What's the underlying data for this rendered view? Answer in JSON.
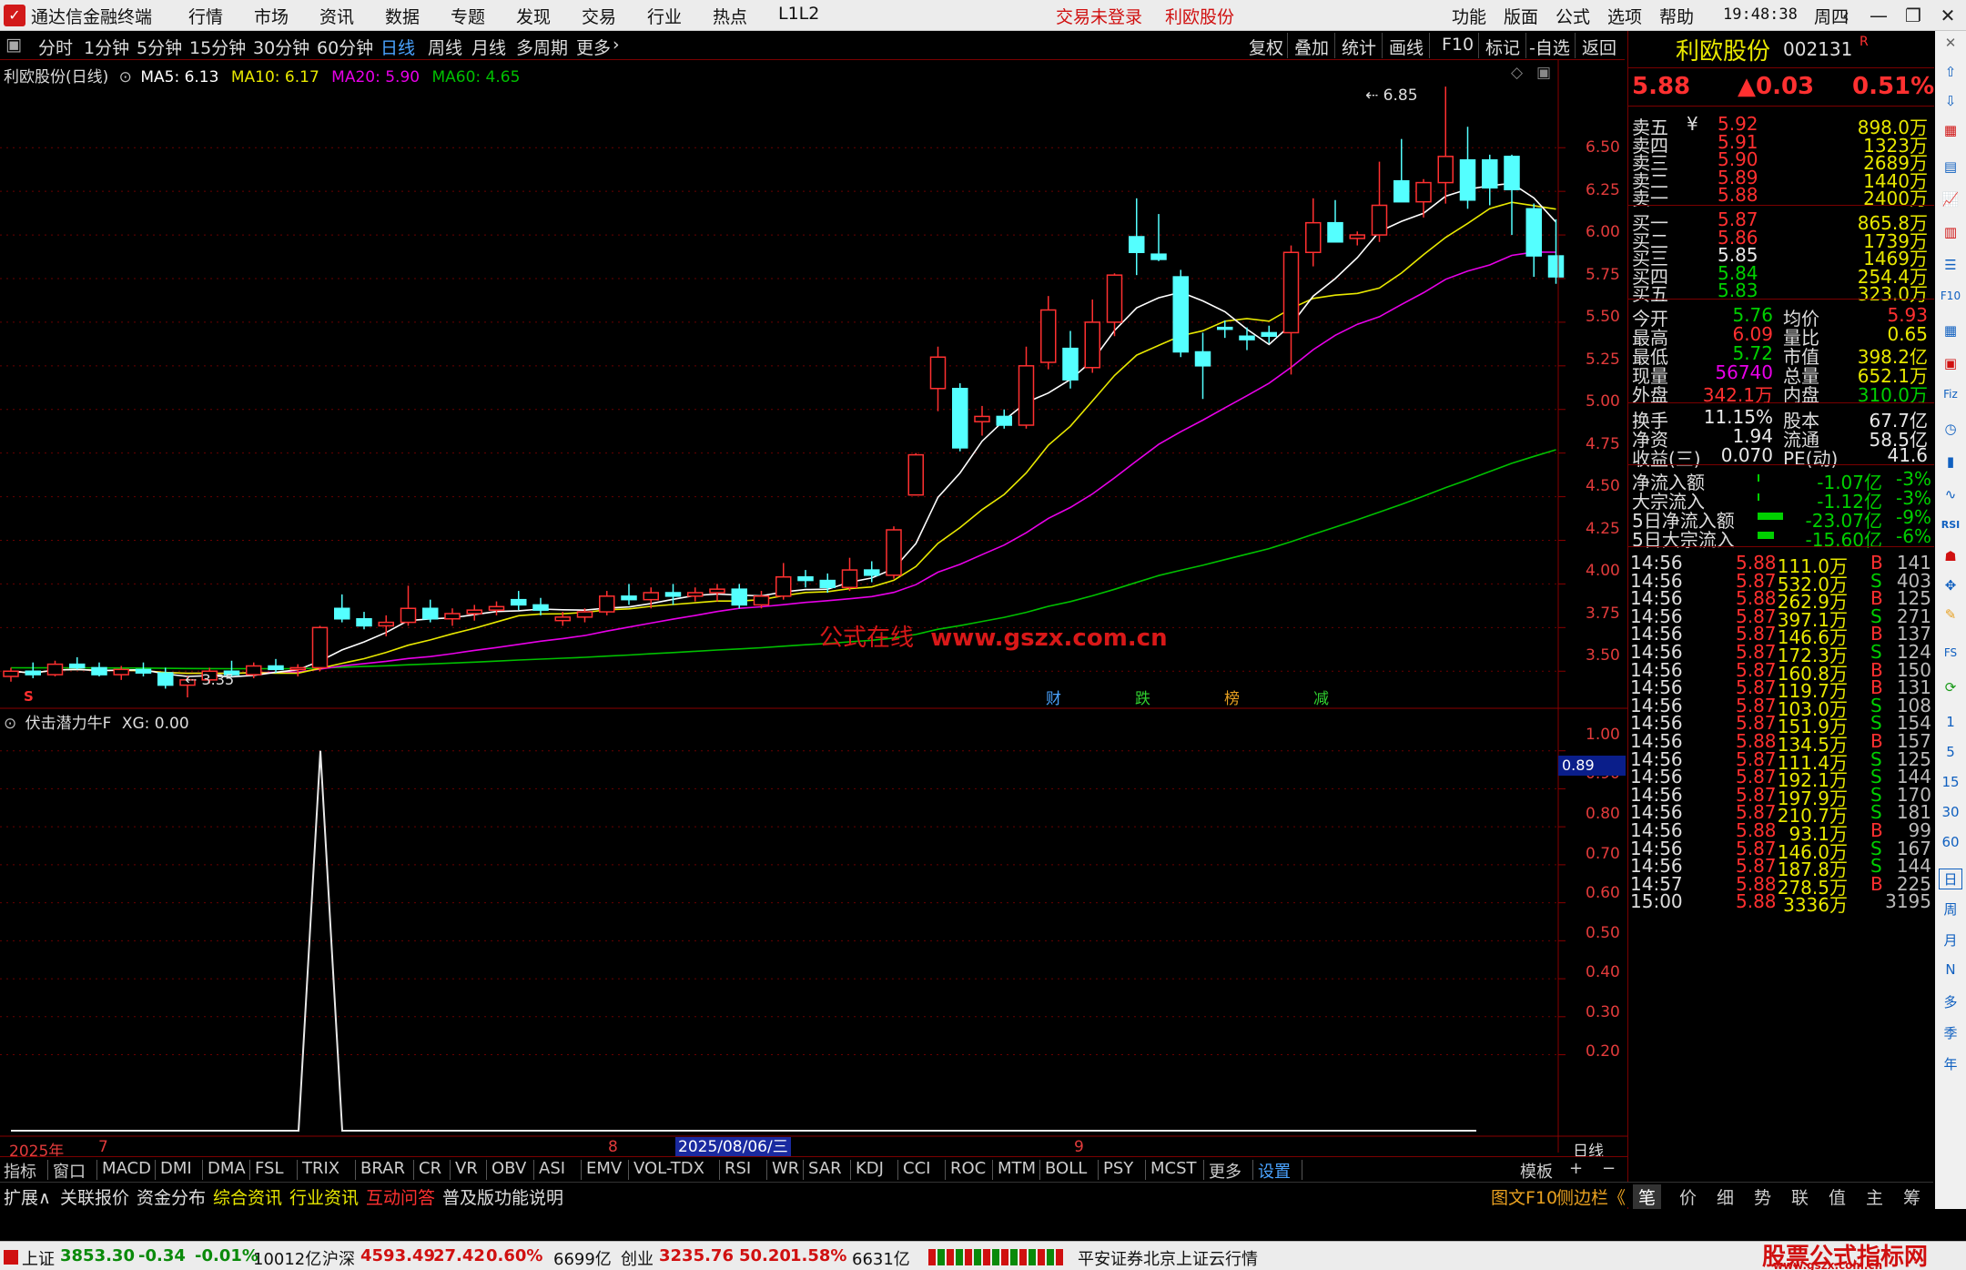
{
  "app": {
    "title": "通达信金融终端"
  },
  "menu": {
    "items": [
      "行情",
      "市场",
      "资讯",
      "数据",
      "专题",
      "发现",
      "交易",
      "行业",
      "热点",
      "L1L2"
    ],
    "login": "交易未登录",
    "stock": "利欧股份",
    "right": [
      "功能",
      "版面",
      "公式",
      "选项",
      "帮助"
    ],
    "time": "19:48:38",
    "weekday": "周四"
  },
  "periods": [
    "分时",
    "1分钟",
    "5分钟",
    "15分钟",
    "30分钟",
    "60分钟",
    "日线",
    "周线",
    "月线",
    "多周期",
    "更多"
  ],
  "active_period": "日线",
  "chart_tools": [
    "复权",
    "叠加",
    "统计",
    "画线",
    "F10",
    "标记",
    "-自选",
    "返回"
  ],
  "legend": {
    "stock": "利欧股份(日线)",
    "ma5": "MA5: 6.13",
    "ma10": "MA10: 6.17",
    "ma20": "MA20: 5.90",
    "ma60": "MA60: 4.65"
  },
  "watermark": {
    "cn": "公式在线",
    "url": "www.gszx.com.cn"
  },
  "price_axis": [
    "6.50",
    "6.25",
    "6.00",
    "5.75",
    "5.50",
    "5.25",
    "5.00",
    "4.75",
    "4.50",
    "4.25",
    "4.00",
    "3.75",
    "3.50"
  ],
  "events": [
    "财",
    "跌",
    "榜",
    "减"
  ],
  "high_label": "6.85",
  "low_label": "3.35",
  "s_mark": "S",
  "indicator": {
    "name": "伏击潜力牛F",
    "value": "XG: 0.00",
    "current": "0.89",
    "axis": [
      "1.00",
      "0.90",
      "0.80",
      "0.70",
      "0.60",
      "0.50",
      "0.40",
      "0.30",
      "0.20"
    ]
  },
  "xaxis": {
    "year": "2025年",
    "m7": "7",
    "m8": "8",
    "cursor_date": "2025/08/06/三",
    "m9": "9",
    "period": "日线"
  },
  "chart_data": {
    "type": "candlestick",
    "ylim": [
      3.35,
      6.95
    ],
    "candles": [
      [
        3.47,
        3.52,
        3.44,
        3.5
      ],
      [
        3.5,
        3.55,
        3.46,
        3.48
      ],
      [
        3.48,
        3.56,
        3.47,
        3.54
      ],
      [
        3.54,
        3.58,
        3.51,
        3.52
      ],
      [
        3.52,
        3.55,
        3.47,
        3.48
      ],
      [
        3.48,
        3.53,
        3.45,
        3.51
      ],
      [
        3.51,
        3.55,
        3.47,
        3.49
      ],
      [
        3.49,
        3.52,
        3.4,
        3.42
      ],
      [
        3.42,
        3.47,
        3.35,
        3.45
      ],
      [
        3.45,
        3.52,
        3.43,
        3.5
      ],
      [
        3.5,
        3.56,
        3.47,
        3.48
      ],
      [
        3.48,
        3.55,
        3.46,
        3.53
      ],
      [
        3.53,
        3.57,
        3.49,
        3.51
      ],
      [
        3.51,
        3.54,
        3.47,
        3.52
      ],
      [
        3.52,
        3.76,
        3.5,
        3.75
      ],
      [
        3.86,
        3.94,
        3.78,
        3.8
      ],
      [
        3.8,
        3.84,
        3.74,
        3.76
      ],
      [
        3.76,
        3.82,
        3.7,
        3.78
      ],
      [
        3.78,
        3.99,
        3.76,
        3.86
      ],
      [
        3.86,
        3.91,
        3.78,
        3.8
      ],
      [
        3.8,
        3.86,
        3.76,
        3.83
      ],
      [
        3.83,
        3.88,
        3.79,
        3.85
      ],
      [
        3.85,
        3.9,
        3.82,
        3.87
      ],
      [
        3.91,
        3.96,
        3.85,
        3.88
      ],
      [
        3.88,
        3.92,
        3.82,
        3.85
      ],
      [
        3.79,
        3.84,
        3.76,
        3.81
      ],
      [
        3.81,
        3.86,
        3.78,
        3.84
      ],
      [
        3.84,
        3.96,
        3.82,
        3.93
      ],
      [
        3.93,
        4.0,
        3.88,
        3.91
      ],
      [
        3.91,
        3.98,
        3.86,
        3.95
      ],
      [
        3.95,
        4.0,
        3.88,
        3.93
      ],
      [
        3.93,
        3.98,
        3.9,
        3.95
      ],
      [
        3.95,
        4.0,
        3.9,
        3.97
      ],
      [
        3.97,
        4.0,
        3.86,
        3.88
      ],
      [
        3.88,
        3.96,
        3.86,
        3.93
      ],
      [
        3.93,
        4.12,
        3.91,
        4.04
      ],
      [
        4.04,
        4.08,
        3.98,
        4.02
      ],
      [
        4.02,
        4.06,
        3.95,
        3.98
      ],
      [
        3.98,
        4.15,
        3.96,
        4.08
      ],
      [
        4.08,
        4.13,
        4.01,
        4.05
      ],
      [
        4.05,
        4.33,
        4.03,
        4.31
      ],
      [
        4.51,
        4.75,
        4.51,
        4.74
      ],
      [
        5.12,
        5.36,
        4.99,
        5.3
      ],
      [
        5.12,
        5.15,
        4.76,
        4.78
      ],
      [
        4.93,
        5.02,
        4.85,
        4.96
      ],
      [
        4.96,
        5.0,
        4.89,
        4.91
      ],
      [
        4.91,
        5.36,
        4.89,
        5.25
      ],
      [
        5.27,
        5.65,
        5.23,
        5.57
      ],
      [
        5.35,
        5.45,
        5.12,
        5.17
      ],
      [
        5.24,
        5.63,
        5.21,
        5.5
      ],
      [
        5.5,
        5.78,
        5.42,
        5.77
      ],
      [
        5.99,
        6.21,
        5.77,
        5.9
      ],
      [
        5.89,
        6.12,
        5.85,
        5.86
      ],
      [
        5.76,
        5.8,
        5.3,
        5.33
      ],
      [
        5.33,
        5.44,
        5.06,
        5.25
      ],
      [
        5.47,
        5.51,
        5.41,
        5.46
      ],
      [
        5.42,
        5.47,
        5.34,
        5.4
      ],
      [
        5.44,
        5.48,
        5.38,
        5.42
      ],
      [
        5.44,
        5.94,
        5.2,
        5.9
      ],
      [
        5.9,
        6.21,
        5.82,
        6.07
      ],
      [
        6.07,
        6.2,
        5.96,
        5.96
      ],
      [
        5.98,
        6.02,
        5.94,
        6.0
      ],
      [
        6.0,
        6.42,
        5.96,
        6.17
      ],
      [
        6.31,
        6.55,
        6.25,
        6.19
      ],
      [
        6.19,
        6.32,
        6.1,
        6.3
      ],
      [
        6.3,
        6.85,
        6.18,
        6.45
      ],
      [
        6.43,
        6.62,
        6.15,
        6.2
      ],
      [
        6.43,
        6.46,
        6.17,
        6.27
      ],
      [
        6.45,
        6.46,
        6.0,
        6.26
      ],
      [
        6.15,
        6.18,
        5.76,
        5.88
      ],
      [
        5.88,
        6.09,
        5.72,
        5.76
      ]
    ],
    "xg": [
      [
        0,
        0
      ],
      [
        15,
        0
      ],
      [
        16,
        1
      ],
      [
        17,
        0
      ],
      [
        70,
        0
      ]
    ]
  },
  "quote": {
    "name": "利欧股份",
    "code": "002131",
    "badge": "R",
    "price": "5.88",
    "change": "▲0.03",
    "pct": "0.51%",
    "asks": [
      [
        "卖五",
        "5.92",
        "898.0万"
      ],
      [
        "卖四",
        "5.91",
        "1323万"
      ],
      [
        "卖三",
        "5.90",
        "2689万"
      ],
      [
        "卖二",
        "5.89",
        "1440万"
      ],
      [
        "卖一",
        "5.88",
        "2400万"
      ]
    ],
    "ask_symbol": "¥",
    "bids": [
      [
        "买一",
        "5.87",
        "865.8万"
      ],
      [
        "买二",
        "5.86",
        "1739万"
      ],
      [
        "买三",
        "5.85",
        "1469万"
      ],
      [
        "买四",
        "5.84",
        "254.4万"
      ],
      [
        "买五",
        "5.83",
        "323.0万"
      ]
    ],
    "stats": [
      [
        "今开",
        "5.76",
        "均价",
        "5.93"
      ],
      [
        "最高",
        "6.09",
        "量比",
        "0.65"
      ],
      [
        "最低",
        "5.72",
        "市值",
        "398.2亿"
      ],
      [
        "现量",
        "56740",
        "总量",
        "652.1万"
      ],
      [
        "外盘",
        "342.1万",
        "内盘",
        "310.0万"
      ]
    ],
    "fin": [
      [
        "换手",
        "11.15%",
        "股本",
        "67.7亿"
      ],
      [
        "净资",
        "1.94",
        "流通",
        "58.5亿"
      ],
      [
        "收益(三)",
        "0.070",
        "PE(动)",
        "41.6"
      ]
    ],
    "flows": [
      [
        "净流入额",
        "-1.07亿",
        "-3%"
      ],
      [
        "大宗流入",
        "-1.12亿",
        "-3%"
      ],
      [
        "5日净流入额",
        "-23.07亿",
        "-9%"
      ],
      [
        "5日大宗流入",
        "-15.60亿",
        "-6%"
      ]
    ]
  },
  "ticks": [
    [
      "14:56",
      "5.88",
      "111.0万",
      "B",
      "141"
    ],
    [
      "14:56",
      "5.87",
      "532.0万",
      "S",
      "403"
    ],
    [
      "14:56",
      "5.88",
      "262.9万",
      "B",
      "125"
    ],
    [
      "14:56",
      "5.87",
      "397.1万",
      "S",
      "271"
    ],
    [
      "14:56",
      "5.87",
      "146.6万",
      "B",
      "137"
    ],
    [
      "14:56",
      "5.87",
      "172.3万",
      "S",
      "124"
    ],
    [
      "14:56",
      "5.87",
      "160.8万",
      "B",
      "150"
    ],
    [
      "14:56",
      "5.87",
      "119.7万",
      "B",
      "131"
    ],
    [
      "14:56",
      "5.87",
      "103.0万",
      "S",
      "108"
    ],
    [
      "14:56",
      "5.87",
      "151.9万",
      "S",
      "154"
    ],
    [
      "14:56",
      "5.88",
      "134.5万",
      "B",
      "157"
    ],
    [
      "14:56",
      "5.87",
      "111.4万",
      "S",
      "125"
    ],
    [
      "14:56",
      "5.87",
      "192.1万",
      "S",
      "144"
    ],
    [
      "14:56",
      "5.87",
      "197.9万",
      "S",
      "170"
    ],
    [
      "14:56",
      "5.87",
      "210.7万",
      "S",
      "181"
    ],
    [
      "14:56",
      "5.88",
      "93.1万",
      "B",
      "99"
    ],
    [
      "14:56",
      "5.87",
      "146.0万",
      "S",
      "167"
    ],
    [
      "14:56",
      "5.87",
      "187.8万",
      "S",
      "144"
    ],
    [
      "14:57",
      "5.88",
      "278.5万",
      "B",
      "225"
    ],
    [
      "15:00",
      "5.88",
      "3336万",
      "",
      "3195"
    ]
  ],
  "indicator_tabs": [
    "指标",
    "窗口",
    "MACD",
    "DMI",
    "DMA",
    "FSL",
    "TRIX",
    "BRAR",
    "CR",
    "VR",
    "OBV",
    "ASI",
    "EMV",
    "VOL-TDX",
    "RSI",
    "WR",
    "SAR",
    "KDJ",
    "CCI",
    "ROC",
    "MTM",
    "BOLL",
    "PSY",
    "MCST",
    "更多",
    "设置"
  ],
  "template": {
    "label": "模板",
    "plus": "+",
    "minus": "−"
  },
  "ext_tabs": [
    "扩展∧",
    "关联报价",
    "资金分布",
    "综合资讯",
    "行业资讯",
    "互动问答",
    "普及版功能说明"
  ],
  "right_tools": {
    "f10": "图文F10",
    "sidebar": "侧边栏《"
  },
  "right_tabs": [
    "笔",
    "价",
    "细",
    "势",
    "联",
    "值",
    "主",
    "筹"
  ],
  "sidebar_labels": [
    "RSI",
    "FS",
    "1",
    "5",
    "15",
    "30",
    "60",
    "日",
    "周",
    "月",
    "N",
    "多",
    "季",
    "年"
  ],
  "status": {
    "sh": [
      "上证",
      "3853.30",
      "-0.34",
      "-0.01%",
      "10012亿"
    ],
    "hs": [
      "沪深",
      "4593.49",
      "27.42",
      "0.60%",
      "6699亿"
    ],
    "cy": [
      "创业",
      "3235.76",
      "50.20",
      "1.58%",
      "6631亿"
    ],
    "broker": "平安证券北京上证云行情",
    "logo1": "股票公式指标网",
    "logo2": "www.gszx.com.cn"
  },
  "colors": {
    "up": "#ff3030",
    "down": "#54ffff",
    "ma5": "#ffffff",
    "ma10": "#e8e800",
    "ma20": "#e800e8",
    "ma60": "#00c000",
    "axis": "#e23b3b"
  }
}
